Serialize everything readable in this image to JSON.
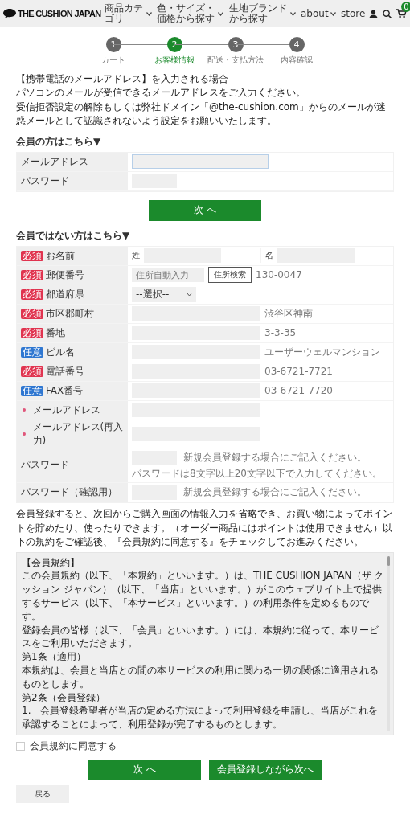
{
  "header": {
    "logo": "THE CUSHION JAPAN",
    "nav": [
      {
        "label": "商品カテゴリ",
        "dropdown": true
      },
      {
        "label": "色・サイズ・価格から探す",
        "dropdown": true
      },
      {
        "label": "生地ブランドから探す",
        "dropdown": true
      },
      {
        "label": "about",
        "dropdown": true
      },
      {
        "label": "store",
        "dropdown": false
      }
    ],
    "cart_count": "0"
  },
  "steps": [
    {
      "number": "1",
      "label": "カート",
      "selected": false
    },
    {
      "number": "2",
      "label": "お客様情報",
      "selected": true
    },
    {
      "number": "3",
      "label": "配送・支払方法",
      "selected": false
    },
    {
      "number": "4",
      "label": "内容確認",
      "selected": false
    }
  ],
  "notice": [
    "【携帯電話のメールアドレス】を入力される場合",
    "パソコンのメールが受信できるメールアドレスをご入力ください。",
    "受信拒否設定の解除もしくは弊社ドメイン「@the-cushion.com」からのメールが迷惑メールとして認識されないよう設定をお願いいたします。"
  ],
  "member": {
    "heading": "会員の方はこちら▼",
    "rows": [
      {
        "label": "メールアドレス",
        "kind": "wide",
        "focused": true
      },
      {
        "label": "パスワード",
        "kind": "short",
        "focused": false
      }
    ],
    "button": "次 へ"
  },
  "guest": {
    "heading": "会員ではない方はこちら▼",
    "rows": [
      {
        "label": "お名前",
        "badge": {
          "text": "必須",
          "color": "#e0334f"
        },
        "kind": "name",
        "parts": [
          "姓",
          "名"
        ]
      },
      {
        "label": "郵便番号",
        "badge": {
          "text": "必須",
          "color": "#e0334f"
        },
        "kind": "postal",
        "placeholder": "住所自動入力",
        "button": "住所検索",
        "hint": "130-0047"
      },
      {
        "label": "都道府県",
        "badge": {
          "text": "必須",
          "color": "#e0334f"
        },
        "kind": "select",
        "value": "--選択--"
      },
      {
        "label": "市区郡町村",
        "badge": {
          "text": "必須",
          "color": "#e0334f"
        },
        "kind": "text",
        "hint": "渋谷区神南"
      },
      {
        "label": "番地",
        "badge": {
          "text": "必須",
          "color": "#e0334f"
        },
        "kind": "text",
        "hint": "3-3-35"
      },
      {
        "label": "ビル名",
        "badge": {
          "text": "任意",
          "color": "#2f77d1"
        },
        "kind": "text",
        "hint": "ユーザーウェルマンション"
      },
      {
        "label": "電話番号",
        "badge": {
          "text": "必須",
          "color": "#e0334f"
        },
        "kind": "text",
        "hint": "03-6721-7721"
      },
      {
        "label": "FAX番号",
        "badge": {
          "text": "任意",
          "color": "#2f77d1"
        },
        "kind": "text",
        "hint": "03-6721-7720"
      },
      {
        "label": "メールアドレス",
        "required_dot": true,
        "kind": "text"
      },
      {
        "label": "メールアドレス(再入力)",
        "required_dot": true,
        "kind": "text"
      },
      {
        "label": "パスワード",
        "kind": "password",
        "hint": "新規会員登録する場合にご記入ください。",
        "note": "パスワードは8文字以上20文字以下で入力してください。"
      },
      {
        "label": "パスワード（確認用）",
        "kind": "password",
        "hint": "新規会員登録する場合にご記入ください。"
      }
    ]
  },
  "agreement_text": "会員登録すると、次回からご購入画面の情報入力を省略でき、お買い物によってポイントを貯めたり、使ったりできます。（オーダー商品にはポイントは使用できません）以下の規約をご確認後、『会員規約に同意する』をチェックしてお進みください。",
  "terms": [
    "【会員規約】",
    "この会員規約（以下、「本規約」といいます。）は、THE CUSHION JAPAN（ザ クッション ジャパン）（以下、「当店」といいます。）がこのウェブサイト上で提供するサービス（以下、「本サービス」といいます。）の利用条件を定めるものです。",
    "登録会員の皆様（以下、「会員」といいます。）には、本規約に従って、本サービスをご利用いただきます。",
    "第1条（適用）",
    "本規約は、会員と当店との間の本サービスの利用に関わる一切の関係に適用されるものとします。",
    "第2条（会員登録）",
    "1.　会員登録希望者が当店の定める方法によって利用登録を申請し、当店がこれを承認することによって、利用登録が完了するものとします。"
  ],
  "agree_checkbox": {
    "label": "会員規約に同意する",
    "checked": false
  },
  "buttons": {
    "next": "次 へ",
    "register_next": "会員登録しながら次へ",
    "back": "戻る"
  }
}
